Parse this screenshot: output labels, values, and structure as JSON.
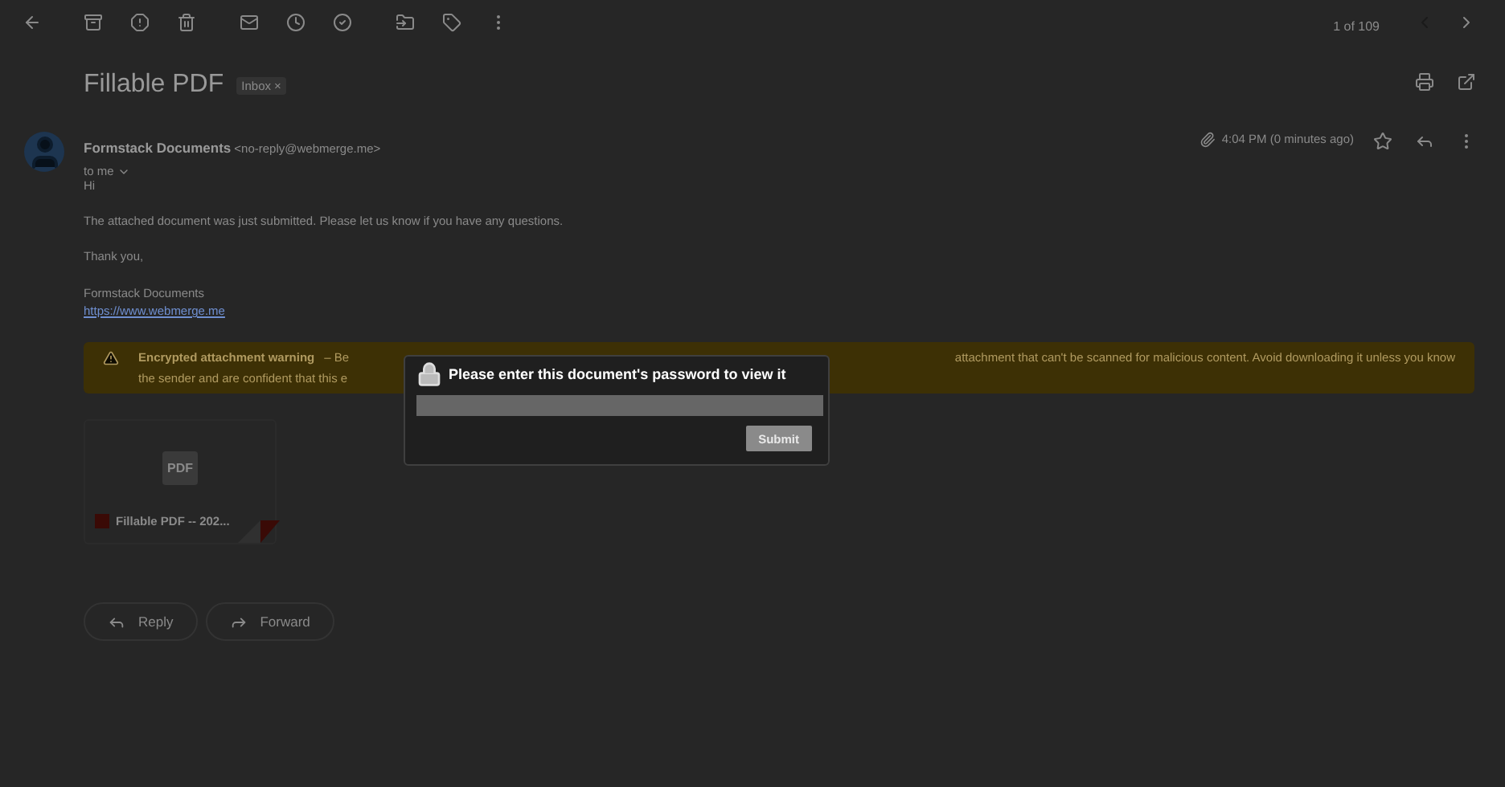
{
  "toolbar": {
    "pagination": "1 of 109"
  },
  "subject": {
    "title": "Fillable PDF",
    "label": {
      "text": "Inbox",
      "close": "×"
    }
  },
  "message": {
    "sender_name": "Formstack Documents",
    "sender_email": "<no-reply@webmerge.me>",
    "recipient": "to me",
    "time": "4:04 PM (0 minutes ago)",
    "body": [
      "Hi",
      "The attached document was just submitted. Please let us know if you have any questions.",
      "Thank you,"
    ],
    "signature": "Formstack Documents",
    "link": "https://www.webmerge.me"
  },
  "warning": {
    "title": "Encrypted attachment warning",
    "line_1_left": "– Be",
    "line_1_right": "attachment that can't be scanned for malicious content. Avoid downloading it unless you know",
    "line_2": "the sender and are confident that this e"
  },
  "attachment": {
    "thumbnail_text": "PDF",
    "name": "Fillable PDF -- 202..."
  },
  "actions": [
    {
      "label": "Reply",
      "kind": "reply"
    },
    {
      "label": "Forward",
      "kind": "forward"
    }
  ],
  "dialog": {
    "title": "Please enter this document's password to view it",
    "submit": {
      "label": "Submit",
      "disabled": true
    }
  }
}
